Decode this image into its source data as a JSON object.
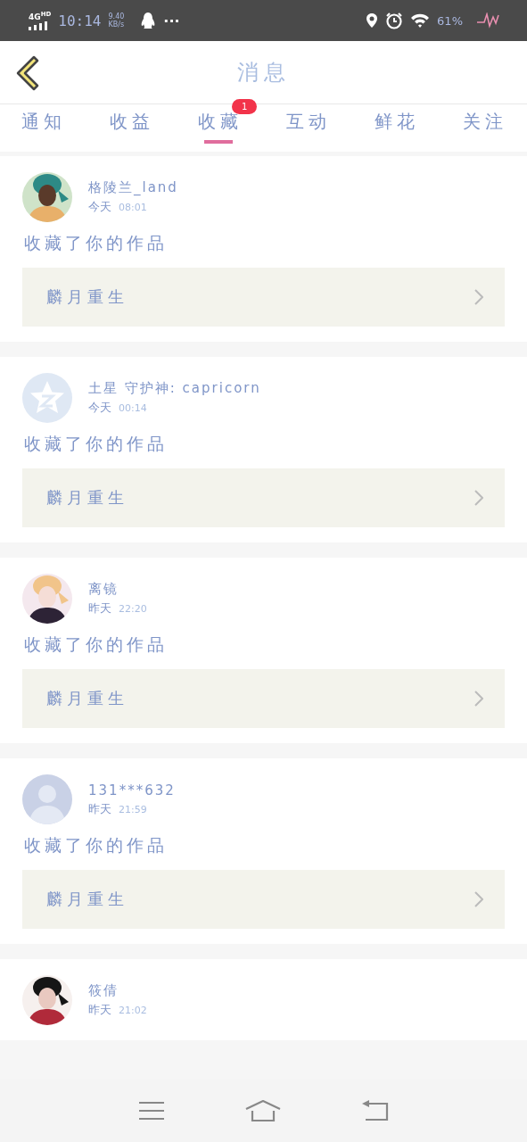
{
  "status_bar": {
    "network": "4G",
    "network_sub": "HD",
    "time": "10:14",
    "speed": "9.40",
    "speed_unit": "KB/s",
    "more": "···",
    "battery": "61%"
  },
  "header": {
    "title": "消息"
  },
  "tabs": [
    {
      "label": "通知",
      "selected": false
    },
    {
      "label": "收益",
      "selected": false
    },
    {
      "label": "收藏",
      "selected": true,
      "badge": "1"
    },
    {
      "label": "互动",
      "selected": false
    },
    {
      "label": "鲜花",
      "selected": false
    },
    {
      "label": "关注",
      "selected": false
    }
  ],
  "messages": [
    {
      "name": "格陵兰_land",
      "day": "今天",
      "time": "08:01",
      "action": "收藏了你的作品",
      "work": "麟月重生"
    },
    {
      "avatar": {
        "kind": "star"
      },
      "name": "土星 守护神: capricorn",
      "day": "今天",
      "time": "00:14",
      "action": "收藏了你的作品",
      "work": "麟月重生"
    },
    {
      "name": "离镜",
      "day": "昨天",
      "time": "22:20",
      "action": "收藏了你的作品",
      "work": "麟月重生"
    },
    {
      "avatar": {
        "kind": "person"
      },
      "name": "131***632",
      "day": "昨天",
      "time": "21:59",
      "action": "收藏了你的作品",
      "work": "麟月重生"
    },
    {
      "name": "筱倩",
      "day": "昨天",
      "time": "21:02"
    }
  ]
}
